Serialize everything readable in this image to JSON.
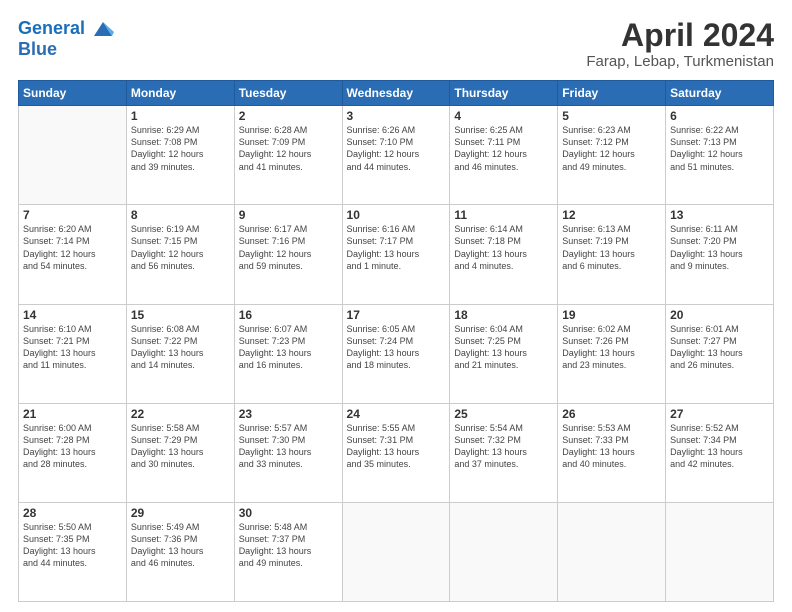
{
  "header": {
    "logo_line1": "General",
    "logo_line2": "Blue",
    "title": "April 2024",
    "subtitle": "Farap, Lebap, Turkmenistan"
  },
  "weekdays": [
    "Sunday",
    "Monday",
    "Tuesday",
    "Wednesday",
    "Thursday",
    "Friday",
    "Saturday"
  ],
  "weeks": [
    [
      {
        "day": "",
        "info": ""
      },
      {
        "day": "1",
        "info": "Sunrise: 6:29 AM\nSunset: 7:08 PM\nDaylight: 12 hours\nand 39 minutes."
      },
      {
        "day": "2",
        "info": "Sunrise: 6:28 AM\nSunset: 7:09 PM\nDaylight: 12 hours\nand 41 minutes."
      },
      {
        "day": "3",
        "info": "Sunrise: 6:26 AM\nSunset: 7:10 PM\nDaylight: 12 hours\nand 44 minutes."
      },
      {
        "day": "4",
        "info": "Sunrise: 6:25 AM\nSunset: 7:11 PM\nDaylight: 12 hours\nand 46 minutes."
      },
      {
        "day": "5",
        "info": "Sunrise: 6:23 AM\nSunset: 7:12 PM\nDaylight: 12 hours\nand 49 minutes."
      },
      {
        "day": "6",
        "info": "Sunrise: 6:22 AM\nSunset: 7:13 PM\nDaylight: 12 hours\nand 51 minutes."
      }
    ],
    [
      {
        "day": "7",
        "info": "Sunrise: 6:20 AM\nSunset: 7:14 PM\nDaylight: 12 hours\nand 54 minutes."
      },
      {
        "day": "8",
        "info": "Sunrise: 6:19 AM\nSunset: 7:15 PM\nDaylight: 12 hours\nand 56 minutes."
      },
      {
        "day": "9",
        "info": "Sunrise: 6:17 AM\nSunset: 7:16 PM\nDaylight: 12 hours\nand 59 minutes."
      },
      {
        "day": "10",
        "info": "Sunrise: 6:16 AM\nSunset: 7:17 PM\nDaylight: 13 hours\nand 1 minute."
      },
      {
        "day": "11",
        "info": "Sunrise: 6:14 AM\nSunset: 7:18 PM\nDaylight: 13 hours\nand 4 minutes."
      },
      {
        "day": "12",
        "info": "Sunrise: 6:13 AM\nSunset: 7:19 PM\nDaylight: 13 hours\nand 6 minutes."
      },
      {
        "day": "13",
        "info": "Sunrise: 6:11 AM\nSunset: 7:20 PM\nDaylight: 13 hours\nand 9 minutes."
      }
    ],
    [
      {
        "day": "14",
        "info": "Sunrise: 6:10 AM\nSunset: 7:21 PM\nDaylight: 13 hours\nand 11 minutes."
      },
      {
        "day": "15",
        "info": "Sunrise: 6:08 AM\nSunset: 7:22 PM\nDaylight: 13 hours\nand 14 minutes."
      },
      {
        "day": "16",
        "info": "Sunrise: 6:07 AM\nSunset: 7:23 PM\nDaylight: 13 hours\nand 16 minutes."
      },
      {
        "day": "17",
        "info": "Sunrise: 6:05 AM\nSunset: 7:24 PM\nDaylight: 13 hours\nand 18 minutes."
      },
      {
        "day": "18",
        "info": "Sunrise: 6:04 AM\nSunset: 7:25 PM\nDaylight: 13 hours\nand 21 minutes."
      },
      {
        "day": "19",
        "info": "Sunrise: 6:02 AM\nSunset: 7:26 PM\nDaylight: 13 hours\nand 23 minutes."
      },
      {
        "day": "20",
        "info": "Sunrise: 6:01 AM\nSunset: 7:27 PM\nDaylight: 13 hours\nand 26 minutes."
      }
    ],
    [
      {
        "day": "21",
        "info": "Sunrise: 6:00 AM\nSunset: 7:28 PM\nDaylight: 13 hours\nand 28 minutes."
      },
      {
        "day": "22",
        "info": "Sunrise: 5:58 AM\nSunset: 7:29 PM\nDaylight: 13 hours\nand 30 minutes."
      },
      {
        "day": "23",
        "info": "Sunrise: 5:57 AM\nSunset: 7:30 PM\nDaylight: 13 hours\nand 33 minutes."
      },
      {
        "day": "24",
        "info": "Sunrise: 5:55 AM\nSunset: 7:31 PM\nDaylight: 13 hours\nand 35 minutes."
      },
      {
        "day": "25",
        "info": "Sunrise: 5:54 AM\nSunset: 7:32 PM\nDaylight: 13 hours\nand 37 minutes."
      },
      {
        "day": "26",
        "info": "Sunrise: 5:53 AM\nSunset: 7:33 PM\nDaylight: 13 hours\nand 40 minutes."
      },
      {
        "day": "27",
        "info": "Sunrise: 5:52 AM\nSunset: 7:34 PM\nDaylight: 13 hours\nand 42 minutes."
      }
    ],
    [
      {
        "day": "28",
        "info": "Sunrise: 5:50 AM\nSunset: 7:35 PM\nDaylight: 13 hours\nand 44 minutes."
      },
      {
        "day": "29",
        "info": "Sunrise: 5:49 AM\nSunset: 7:36 PM\nDaylight: 13 hours\nand 46 minutes."
      },
      {
        "day": "30",
        "info": "Sunrise: 5:48 AM\nSunset: 7:37 PM\nDaylight: 13 hours\nand 49 minutes."
      },
      {
        "day": "",
        "info": ""
      },
      {
        "day": "",
        "info": ""
      },
      {
        "day": "",
        "info": ""
      },
      {
        "day": "",
        "info": ""
      }
    ]
  ]
}
